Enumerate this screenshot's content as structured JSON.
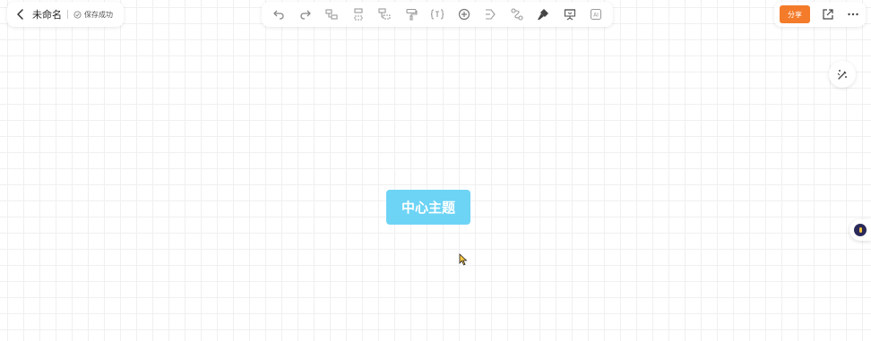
{
  "header": {
    "title": "未命名",
    "status": "保存成功"
  },
  "toolbar": {
    "tools": [
      {
        "name": "undo-icon"
      },
      {
        "name": "redo-icon"
      },
      {
        "name": "insert-child-node-icon"
      },
      {
        "name": "insert-sibling-node-icon"
      },
      {
        "name": "insert-parent-node-icon"
      },
      {
        "name": "format-painter-icon"
      },
      {
        "name": "summary-icon"
      },
      {
        "name": "add-icon"
      },
      {
        "name": "outline-frame-icon"
      },
      {
        "name": "relation-line-icon"
      },
      {
        "name": "style-icon"
      },
      {
        "name": "presentation-icon"
      },
      {
        "name": "ai-icon",
        "label": "AI"
      }
    ]
  },
  "actions": {
    "share_label": "分享"
  },
  "canvas": {
    "central_topic": "中心主题",
    "node_color": "#6dd4f5"
  },
  "colors": {
    "accent": "#f47b2a",
    "status_ok": "#888888"
  }
}
